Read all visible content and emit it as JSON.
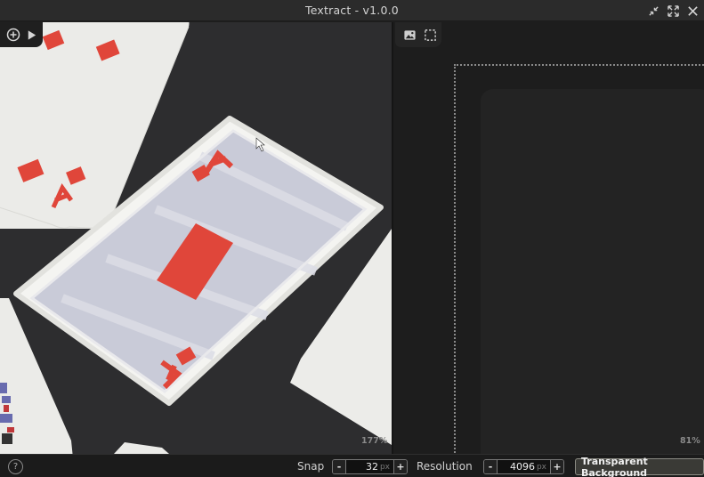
{
  "app": {
    "title": "Textract - v1.0.0"
  },
  "window_controls": {
    "icons": [
      "collapse-arrows-icon",
      "expand-arrows-icon",
      "close-icon"
    ]
  },
  "left_pane": {
    "tools": [
      "add-image-icon",
      "play-icon"
    ],
    "zoom": "177%",
    "image_description_icons": [
      "photo-of-playing-cards"
    ]
  },
  "right_pane": {
    "tools": [
      "image-icon",
      "selection-icon"
    ],
    "zoom": "81%"
  },
  "statusbar": {
    "help_label": "?",
    "snap": {
      "label": "Snap",
      "minus": "-",
      "value": "32",
      "unit": "px",
      "plus": "+"
    },
    "resolution": {
      "label": "Resolution",
      "minus": "-",
      "value": "4096",
      "unit": "px",
      "plus": "+"
    },
    "transparent_button": "Transparent Background"
  },
  "colors": {
    "card_red": "#e0463a",
    "card_face": "#f1f1ee",
    "sleeve_tint": "#c9cbd8",
    "table": "#2a2b2c"
  }
}
